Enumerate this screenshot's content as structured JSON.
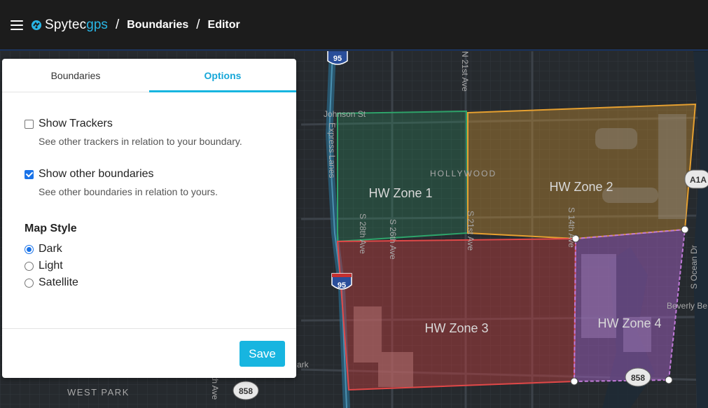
{
  "header": {
    "logo_part1": "Spytec",
    "logo_part2": "gps",
    "breadcrumb": [
      "Boundaries",
      "Editor"
    ],
    "separator": "/"
  },
  "panel": {
    "tabs": [
      {
        "label": "Boundaries",
        "active": false
      },
      {
        "label": "Options",
        "active": true
      }
    ],
    "options": [
      {
        "label": "Show Trackers",
        "description": "See other trackers in relation to your boundary.",
        "checked": false
      },
      {
        "label": "Show other boundaries",
        "description": "See other boundaries in relation to yours.",
        "checked": true
      }
    ],
    "map_style_title": "Map Style",
    "map_styles": [
      {
        "label": "Dark",
        "selected": true
      },
      {
        "label": "Light",
        "selected": false
      },
      {
        "label": "Satellite",
        "selected": false
      }
    ],
    "save_label": "Save"
  },
  "map": {
    "zones": [
      {
        "name": "HW Zone 1",
        "color": "#2ea36a"
      },
      {
        "name": "HW Zone 2",
        "color": "#e6a030"
      },
      {
        "name": "HW Zone 3",
        "color": "#d64040"
      },
      {
        "name": "HW Zone 4",
        "color": "#a060c0"
      }
    ],
    "labels": {
      "hollywood": "HOLLYWOOD",
      "johnson": "Johnson St",
      "express": "Express Lanes",
      "n21": "N 21st Ave",
      "s28": "S 28th Ave",
      "s26": "S 26th Ave",
      "s21": "S 21st Ave",
      "s14": "S 14th Ave",
      "ocean": "S Ocean Dr",
      "beverly": "Beverly Be",
      "westpark": "WEST PARK",
      "park": "ark",
      "th_ave": "th Ave"
    },
    "shields": {
      "i95_top": "95",
      "i95_mid": "95",
      "a1a": "A1A",
      "r858_left": "858",
      "r858_right": "858"
    },
    "colors": {
      "background": "#262a2e",
      "water": "#1e2a36",
      "road": "#3a3f45"
    }
  }
}
